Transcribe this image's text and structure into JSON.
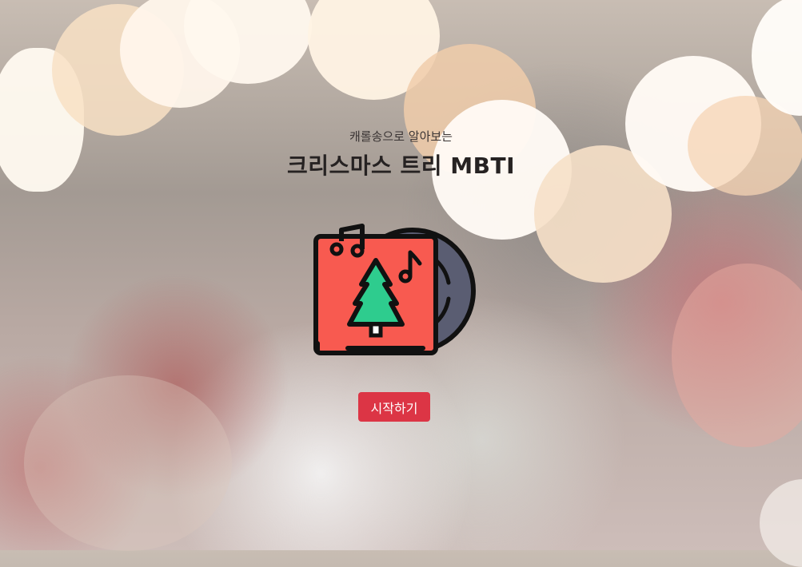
{
  "header": {
    "subtitle": "캐롤송으로 알아보는",
    "title": "크리스마스 트리 MBTI"
  },
  "hero": {
    "icon": "christmas-music-album-icon"
  },
  "actions": {
    "start_label": "시작하기"
  },
  "colors": {
    "start_button": "#dc3545",
    "album_cover": "#f85a50",
    "tree": "#2ecc8e",
    "record": "#5a5d72"
  }
}
